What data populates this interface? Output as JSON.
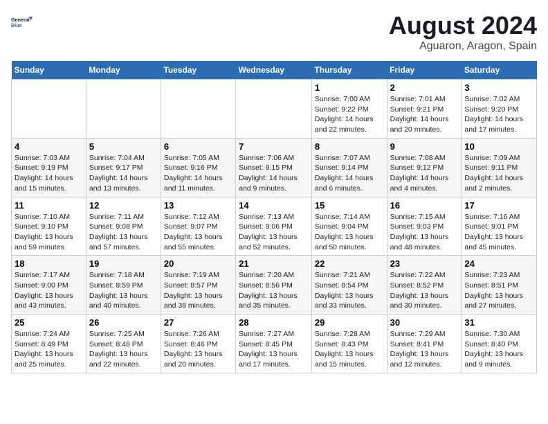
{
  "header": {
    "logo_line1": "General",
    "logo_line2": "Blue",
    "title": "August 2024",
    "subtitle": "Aguaron, Aragon, Spain"
  },
  "days_of_week": [
    "Sunday",
    "Monday",
    "Tuesday",
    "Wednesday",
    "Thursday",
    "Friday",
    "Saturday"
  ],
  "weeks": [
    [
      {
        "num": "",
        "info": ""
      },
      {
        "num": "",
        "info": ""
      },
      {
        "num": "",
        "info": ""
      },
      {
        "num": "",
        "info": ""
      },
      {
        "num": "1",
        "info": "Sunrise: 7:00 AM\nSunset: 9:22 PM\nDaylight: 14 hours\nand 22 minutes."
      },
      {
        "num": "2",
        "info": "Sunrise: 7:01 AM\nSunset: 9:21 PM\nDaylight: 14 hours\nand 20 minutes."
      },
      {
        "num": "3",
        "info": "Sunrise: 7:02 AM\nSunset: 9:20 PM\nDaylight: 14 hours\nand 17 minutes."
      }
    ],
    [
      {
        "num": "4",
        "info": "Sunrise: 7:03 AM\nSunset: 9:19 PM\nDaylight: 14 hours\nand 15 minutes."
      },
      {
        "num": "5",
        "info": "Sunrise: 7:04 AM\nSunset: 9:17 PM\nDaylight: 14 hours\nand 13 minutes."
      },
      {
        "num": "6",
        "info": "Sunrise: 7:05 AM\nSunset: 9:16 PM\nDaylight: 14 hours\nand 11 minutes."
      },
      {
        "num": "7",
        "info": "Sunrise: 7:06 AM\nSunset: 9:15 PM\nDaylight: 14 hours\nand 9 minutes."
      },
      {
        "num": "8",
        "info": "Sunrise: 7:07 AM\nSunset: 9:14 PM\nDaylight: 14 hours\nand 6 minutes."
      },
      {
        "num": "9",
        "info": "Sunrise: 7:08 AM\nSunset: 9:12 PM\nDaylight: 14 hours\nand 4 minutes."
      },
      {
        "num": "10",
        "info": "Sunrise: 7:09 AM\nSunset: 9:11 PM\nDaylight: 14 hours\nand 2 minutes."
      }
    ],
    [
      {
        "num": "11",
        "info": "Sunrise: 7:10 AM\nSunset: 9:10 PM\nDaylight: 13 hours\nand 59 minutes."
      },
      {
        "num": "12",
        "info": "Sunrise: 7:11 AM\nSunset: 9:08 PM\nDaylight: 13 hours\nand 57 minutes."
      },
      {
        "num": "13",
        "info": "Sunrise: 7:12 AM\nSunset: 9:07 PM\nDaylight: 13 hours\nand 55 minutes."
      },
      {
        "num": "14",
        "info": "Sunrise: 7:13 AM\nSunset: 9:06 PM\nDaylight: 13 hours\nand 52 minutes."
      },
      {
        "num": "15",
        "info": "Sunrise: 7:14 AM\nSunset: 9:04 PM\nDaylight: 13 hours\nand 50 minutes."
      },
      {
        "num": "16",
        "info": "Sunrise: 7:15 AM\nSunset: 9:03 PM\nDaylight: 13 hours\nand 48 minutes."
      },
      {
        "num": "17",
        "info": "Sunrise: 7:16 AM\nSunset: 9:01 PM\nDaylight: 13 hours\nand 45 minutes."
      }
    ],
    [
      {
        "num": "18",
        "info": "Sunrise: 7:17 AM\nSunset: 9:00 PM\nDaylight: 13 hours\nand 43 minutes."
      },
      {
        "num": "19",
        "info": "Sunrise: 7:18 AM\nSunset: 8:59 PM\nDaylight: 13 hours\nand 40 minutes."
      },
      {
        "num": "20",
        "info": "Sunrise: 7:19 AM\nSunset: 8:57 PM\nDaylight: 13 hours\nand 38 minutes."
      },
      {
        "num": "21",
        "info": "Sunrise: 7:20 AM\nSunset: 8:56 PM\nDaylight: 13 hours\nand 35 minutes."
      },
      {
        "num": "22",
        "info": "Sunrise: 7:21 AM\nSunset: 8:54 PM\nDaylight: 13 hours\nand 33 minutes."
      },
      {
        "num": "23",
        "info": "Sunrise: 7:22 AM\nSunset: 8:52 PM\nDaylight: 13 hours\nand 30 minutes."
      },
      {
        "num": "24",
        "info": "Sunrise: 7:23 AM\nSunset: 8:51 PM\nDaylight: 13 hours\nand 27 minutes."
      }
    ],
    [
      {
        "num": "25",
        "info": "Sunrise: 7:24 AM\nSunset: 8:49 PM\nDaylight: 13 hours\nand 25 minutes."
      },
      {
        "num": "26",
        "info": "Sunrise: 7:25 AM\nSunset: 8:48 PM\nDaylight: 13 hours\nand 22 minutes."
      },
      {
        "num": "27",
        "info": "Sunrise: 7:26 AM\nSunset: 8:46 PM\nDaylight: 13 hours\nand 20 minutes."
      },
      {
        "num": "28",
        "info": "Sunrise: 7:27 AM\nSunset: 8:45 PM\nDaylight: 13 hours\nand 17 minutes."
      },
      {
        "num": "29",
        "info": "Sunrise: 7:28 AM\nSunset: 8:43 PM\nDaylight: 13 hours\nand 15 minutes."
      },
      {
        "num": "30",
        "info": "Sunrise: 7:29 AM\nSunset: 8:41 PM\nDaylight: 13 hours\nand 12 minutes."
      },
      {
        "num": "31",
        "info": "Sunrise: 7:30 AM\nSunset: 8:40 PM\nDaylight: 13 hours\nand 9 minutes."
      }
    ]
  ]
}
